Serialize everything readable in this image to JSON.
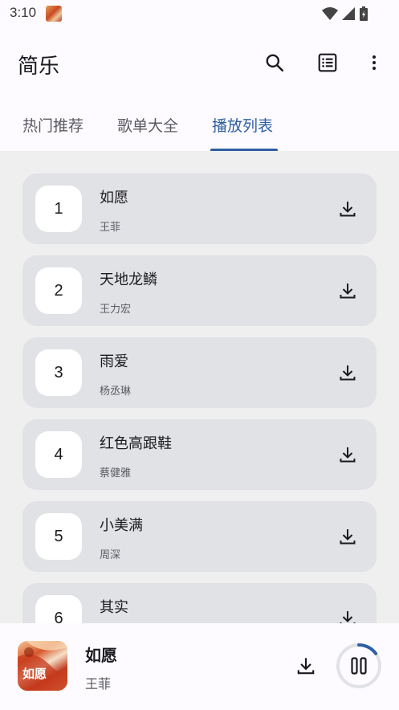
{
  "status_bar": {
    "time": "3:10"
  },
  "app_bar": {
    "title": "简乐"
  },
  "tabs": [
    {
      "label": "热门推荐",
      "active": false
    },
    {
      "label": "歌单大全",
      "active": false
    },
    {
      "label": "播放列表",
      "active": true
    }
  ],
  "playlist": [
    {
      "index": "1",
      "title": "如愿",
      "artist": "王菲"
    },
    {
      "index": "2",
      "title": "天地龙鳞",
      "artist": "王力宏"
    },
    {
      "index": "3",
      "title": "雨爱",
      "artist": "杨丞琳"
    },
    {
      "index": "4",
      "title": "红色高跟鞋",
      "artist": "蔡健雅"
    },
    {
      "index": "5",
      "title": "小美满",
      "artist": "周深"
    },
    {
      "index": "6",
      "title": "其实",
      "artist": ""
    }
  ],
  "now_playing": {
    "title": "如愿",
    "artist": "王菲",
    "cover_text": "如愿",
    "progress": 0.15
  },
  "colors": {
    "accent": "#2f5fa4",
    "row_bg": "#e1e2e6",
    "list_bg": "#efefef"
  },
  "icons": {
    "search": "search-icon",
    "queue": "list-icon",
    "more": "more-vert-icon",
    "download": "download-icon",
    "pause": "pause-icon"
  }
}
